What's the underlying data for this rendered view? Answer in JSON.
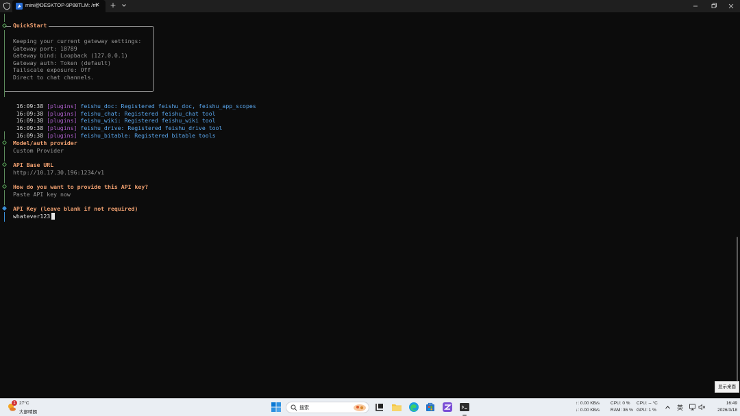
{
  "titlebar": {
    "tab_title": "mini@DESKTOP-9P88TLM: /m",
    "tab_close": "✕",
    "new_tab": "+"
  },
  "terminal": {
    "quickstart": {
      "title": "QuickStart",
      "lines": [
        "Keeping your current gateway settings:",
        "Gateway port: 18789",
        "Gateway bind: Loopback (127.0.0.1)",
        "Gateway auth: Token (default)",
        "Tailscale exposure: Off",
        "Direct to chat channels."
      ]
    },
    "logs": [
      {
        "time": "16:09:38",
        "tag": "[plugins]",
        "message": "feishu_doc: Registered feishu_doc, feishu_app_scopes"
      },
      {
        "time": "16:09:38",
        "tag": "[plugins]",
        "message": "feishu_chat: Registered feishu_chat tool"
      },
      {
        "time": "16:09:38",
        "tag": "[plugins]",
        "message": "feishu_wiki: Registered feishu_wiki tool"
      },
      {
        "time": "16:09:38",
        "tag": "[plugins]",
        "message": "feishu_drive: Registered feishu_drive tool"
      },
      {
        "time": "16:09:38",
        "tag": "[plugins]",
        "message": "feishu_bitable: Registered bitable tools"
      }
    ],
    "prompts": [
      {
        "question": "Model/auth provider",
        "answer": "Custom Provider"
      },
      {
        "question": "API Base URL",
        "answer": "http://10.17.30.196:1234/v1"
      },
      {
        "question": "How do you want to provide this API key?",
        "answer": "Paste API key now"
      },
      {
        "question": "API Key (leave blank if not required)",
        "answer": "whatever123"
      }
    ]
  },
  "show_desktop": "显示桌面",
  "taskbar": {
    "weather": {
      "badge": "1",
      "temp": "27°C",
      "desc": "大部晴朗"
    },
    "search_label": "搜索",
    "net_up": "↑: 0.00 KB/s",
    "net_down": "↓: 0.00 KB/s",
    "cpu": "CPU: 0 %",
    "cpu_temp": "CPU: -- °C",
    "ram": "RAM: 36 %",
    "gpu": "GPU: 1 %",
    "ime": "英",
    "time": "16:49",
    "date": "2026/3/18"
  },
  "colors": {
    "prompt_orange": "#f0a070",
    "plugin_tag": "#b060d0",
    "log_message": "#5aa8f0",
    "gutter_green": "#5fb05f",
    "active_marker": "#3a8fd8"
  }
}
